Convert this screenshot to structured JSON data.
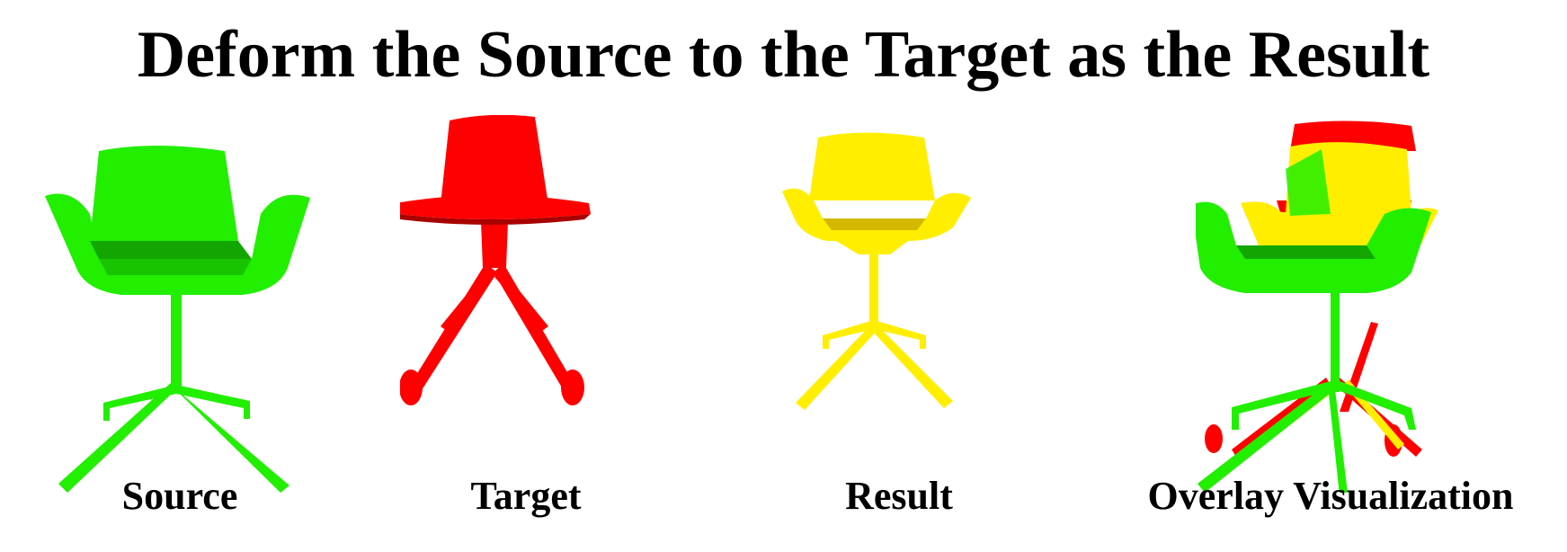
{
  "title": "Deform the Source to the Target as the Result",
  "panels": [
    {
      "label": "Source",
      "color": "#22ee00"
    },
    {
      "label": "Target",
      "color": "#ff0000"
    },
    {
      "label": "Result",
      "color": "#ffee00"
    },
    {
      "label": "Overlay Visualization"
    }
  ]
}
